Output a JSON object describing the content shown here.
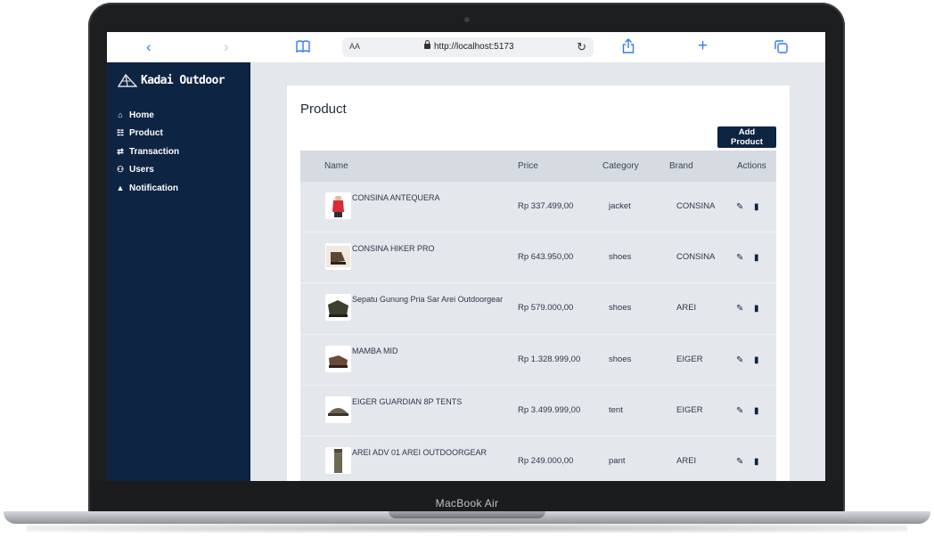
{
  "device": {
    "label": "MacBook Air"
  },
  "browser": {
    "text_size_label": "AA",
    "url": "http://localhost:5173",
    "icons": [
      "chevron-left-icon",
      "chevron-right-icon",
      "book-icon",
      "lock-icon",
      "reload-icon",
      "share-icon",
      "plus-icon",
      "tabs-icon"
    ]
  },
  "sidebar": {
    "brand_left": "Kadai",
    "brand_right": " Outdoor",
    "items": [
      {
        "label": "Home",
        "icon": "home-icon"
      },
      {
        "label": "Product",
        "icon": "list-icon"
      },
      {
        "label": "Transaction",
        "icon": "transaction-icon"
      },
      {
        "label": "Users",
        "icon": "users-icon"
      },
      {
        "label": "Notification",
        "icon": "bell-icon"
      }
    ]
  },
  "page": {
    "title": "Product",
    "add_button": "Add Product"
  },
  "table": {
    "columns": [
      "Name",
      "Price",
      "Category",
      "Brand",
      "Actions"
    ],
    "rows": [
      {
        "name": "CONSINA ANTEQUERA",
        "price": "Rp 337.499,00",
        "category": "jacket",
        "brand": "CONSINA"
      },
      {
        "name": "CONSINA HIKER PRO",
        "price": "Rp 643.950,00",
        "category": "shoes",
        "brand": "CONSINA"
      },
      {
        "name": "Sepatu Gunung Pria Sar Arei Outdoorgear",
        "price": "Rp 579.000,00",
        "category": "shoes",
        "brand": "AREI"
      },
      {
        "name": "MAMBA MID",
        "price": "Rp 1.328.999,00",
        "category": "shoes",
        "brand": "EIGER"
      },
      {
        "name": "EIGER GUARDIAN 8P TENTS",
        "price": "Rp 3.499.999,00",
        "category": "tent",
        "brand": "EIGER"
      },
      {
        "name": "AREI ADV 01 AREI OUTDOORGEAR",
        "price": "Rp 249.000,00",
        "category": "pant",
        "brand": "AREI"
      }
    ]
  },
  "colors": {
    "sidebar_bg": "#0e2443",
    "content_bg": "#e4e7ec",
    "accent": "#2f7cf6"
  }
}
